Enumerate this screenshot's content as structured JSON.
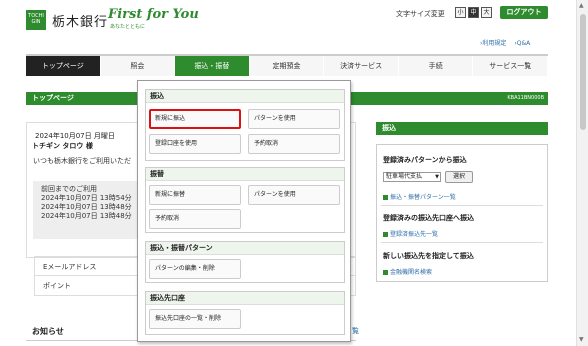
{
  "header": {
    "logo_text": "TOCHI GIN",
    "bank_name": "栃木銀行",
    "slogan": "First for You",
    "slogan_sub": "あなたとともに",
    "font_size_label": "文字サイズ変更",
    "font_sizes": [
      "小",
      "中",
      "大"
    ],
    "logout_label": "ログアウト",
    "links": [
      "›利用規定",
      "›Q&A"
    ]
  },
  "nav": {
    "items": [
      "トップページ",
      "照会",
      "振込・振替",
      "定期預金",
      "決済サービス",
      "手続",
      "サービス一覧"
    ]
  },
  "page": {
    "title": "トップページ",
    "code": "KBA11BN000B"
  },
  "welcome": {
    "date": "2024年10月07日 月曜日",
    "user": "トチギン タロウ 様",
    "thanks": "いつも栃木銀行をご利用いただ",
    "history_title": "前回までのご利用",
    "history_rows": [
      "2024年10月07日 13時54分",
      "2024年10月07日 13時48分",
      "2024年10月07日 13時48分"
    ]
  },
  "info_rows": [
    "Eメールアドレス",
    "ポイント"
  ],
  "notice": {
    "title": "お知らせ",
    "more": "覧"
  },
  "right_panel": {
    "header": "振込",
    "pattern_title": "登録済みパターンから振込",
    "select_value": "駐車場代支払",
    "select_button": "選択",
    "pattern_link": "振込・振替パターン一覧",
    "registered_title": "登録済みの振込先口座へ振込",
    "registered_link": "登録済振込先一覧",
    "new_title": "新しい振込先を指定して振込",
    "new_link": "金融機関名検索"
  },
  "dropdown": {
    "furikomi": {
      "title": "振込",
      "buttons": [
        "新規に振込",
        "パターンを使用",
        "登録口座を使用",
        "予約取消"
      ]
    },
    "furikae": {
      "title": "振替",
      "buttons": [
        "新規に振替",
        "パターンを使用",
        "予約取消"
      ]
    },
    "pattern": {
      "title": "振込・振替パターン",
      "buttons": [
        "パターンの編集・削除"
      ]
    },
    "account": {
      "title": "振込先口座",
      "buttons": [
        "振込先口座の一覧・削除"
      ]
    }
  },
  "colors": {
    "brand_green": "#2e8b2e",
    "highlight_red": "#dd1111",
    "link_blue": "#2e6ea8"
  }
}
